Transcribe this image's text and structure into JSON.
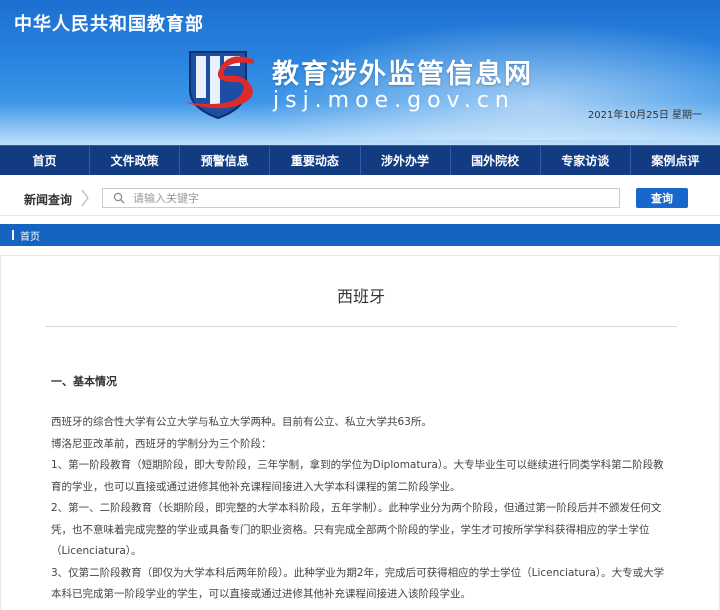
{
  "header": {
    "ministry": "中华人民共和国教育部",
    "site_name": "教育涉外监管信息网",
    "site_domain": "jsj.moe.gov.cn",
    "date": "2021年10月25日  星期一",
    "logo_icon": "jsj-logo-icon"
  },
  "nav": {
    "items": [
      {
        "label": "首页"
      },
      {
        "label": "文件政策"
      },
      {
        "label": "预警信息"
      },
      {
        "label": "重要动态"
      },
      {
        "label": "涉外办学"
      },
      {
        "label": "国外院校"
      },
      {
        "label": "专家访谈"
      },
      {
        "label": "案例点评"
      }
    ]
  },
  "search": {
    "label": "新闻查询",
    "placeholder": "请输入关键字",
    "button": "查询"
  },
  "breadcrumb": {
    "home": "首页"
  },
  "article": {
    "title": "西班牙",
    "section1": "一、基本情况",
    "paragraphs": [
      "西班牙的综合性大学有公立大学与私立大学两种。目前有公立、私立大学共63所。",
      "博洛尼亚改革前，西班牙的学制分为三个阶段：",
      "1、第一阶段教育（短期阶段，即大专阶段，三年学制，拿到的学位为Diplomatura）。大专毕业生可以继续进行同类学科第二阶段教育的学业，也可以直接或通过进修其他补充课程间接进入大学本科课程的第二阶段学业。",
      "2、第一、二阶段教育（长期阶段，即完整的大学本科阶段，五年学制）。此种学业分为两个阶段，但通过第一阶段后并不颁发任何文凭，也不意味着完成完整的学业或具备专门的职业资格。只有完成全部两个阶段的学业，学生才可按所学学科获得相应的学士学位（Licenciatura）。",
      "3、仅第二阶段教育（即仅为大学本科后两年阶段）。此种学业为期2年，完成后可获得相应的学士学位（Licenciatura）。大专或大学本科已完成第一阶段学业的学生，可以直接或通过进修其他补充课程间接进入该阶段学业。"
    ]
  },
  "colors": {
    "nav_bg": "#123b82",
    "accent": "#1664c2",
    "logo_red": "#e02a2a"
  }
}
